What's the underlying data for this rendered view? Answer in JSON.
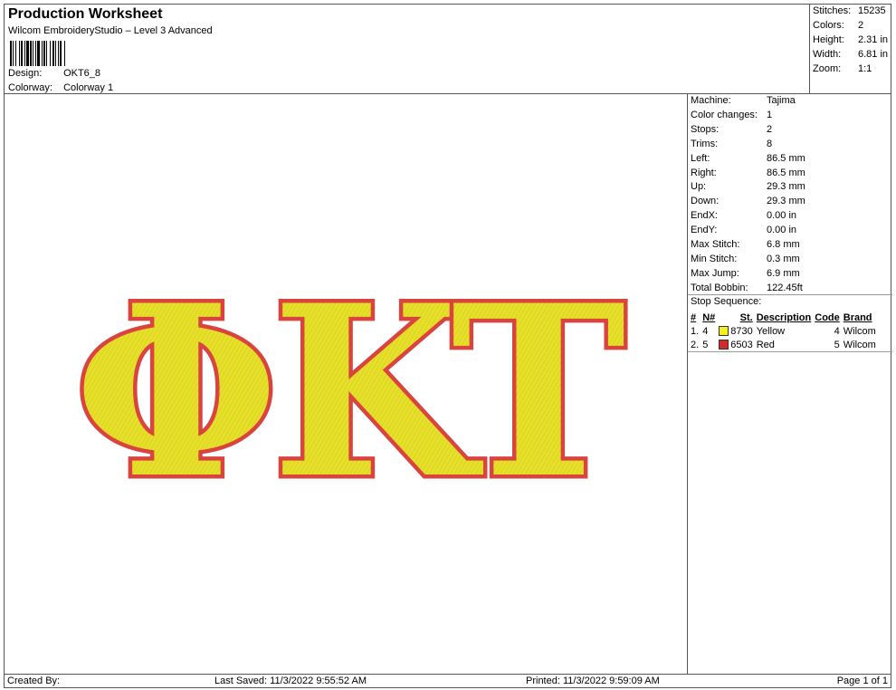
{
  "header": {
    "title": "Production Worksheet",
    "subtitle": "Wilcom EmbroideryStudio – Level 3 Advanced",
    "design_label": "Design:",
    "design_value": "OKT6_8",
    "colorway_label": "Colorway:",
    "colorway_value": "Colorway 1"
  },
  "summary": [
    {
      "label": "Stitches:",
      "value": "15235"
    },
    {
      "label": "Colors:",
      "value": "2"
    },
    {
      "label": "Height:",
      "value": "2.31 in"
    },
    {
      "label": "Width:",
      "value": "6.81 in"
    },
    {
      "label": "Zoom:",
      "value": "1:1"
    }
  ],
  "design": {
    "letters": [
      "Φ",
      "K",
      "T"
    ],
    "fill_color": "#e7e02a",
    "outline_color": "#d9443f"
  },
  "machine_info": [
    {
      "label": "Machine:",
      "value": "Tajima"
    },
    {
      "label": "Color changes:",
      "value": "1"
    },
    {
      "label": "Stops:",
      "value": "2"
    },
    {
      "label": "Trims:",
      "value": "8"
    },
    {
      "label": "Left:",
      "value": "86.5 mm"
    },
    {
      "label": "Right:",
      "value": "86.5 mm"
    },
    {
      "label": "Up:",
      "value": "29.3 mm"
    },
    {
      "label": "Down:",
      "value": "29.3 mm"
    },
    {
      "label": "EndX:",
      "value": "0.00 in"
    },
    {
      "label": "EndY:",
      "value": "0.00 in"
    },
    {
      "label": "Max Stitch:",
      "value": "6.8 mm"
    },
    {
      "label": "Min Stitch:",
      "value": "0.3 mm"
    },
    {
      "label": "Max Jump:",
      "value": "6.9 mm"
    },
    {
      "label": "Total Bobbin:",
      "value": "122.45ft"
    }
  ],
  "stop_sequence": {
    "title": "Stop Sequence:",
    "headers": [
      "#",
      "N#",
      "St.",
      "Description",
      "Code",
      "Brand"
    ],
    "rows": [
      {
        "num": "1.",
        "needle": "4",
        "color": "#f5ef1c",
        "stitches": "8730",
        "description": "Yellow",
        "code": "4",
        "brand": "Wilcom"
      },
      {
        "num": "2.",
        "needle": "5",
        "color": "#d12a2a",
        "stitches": "6503",
        "description": "Red",
        "code": "5",
        "brand": "Wilcom"
      }
    ]
  },
  "footer": {
    "created_by": "Created By:",
    "last_saved": "Last Saved: 11/3/2022 9:55:52 AM",
    "printed": "Printed: 11/3/2022 9:59:09 AM",
    "page": "Page 1 of 1"
  }
}
